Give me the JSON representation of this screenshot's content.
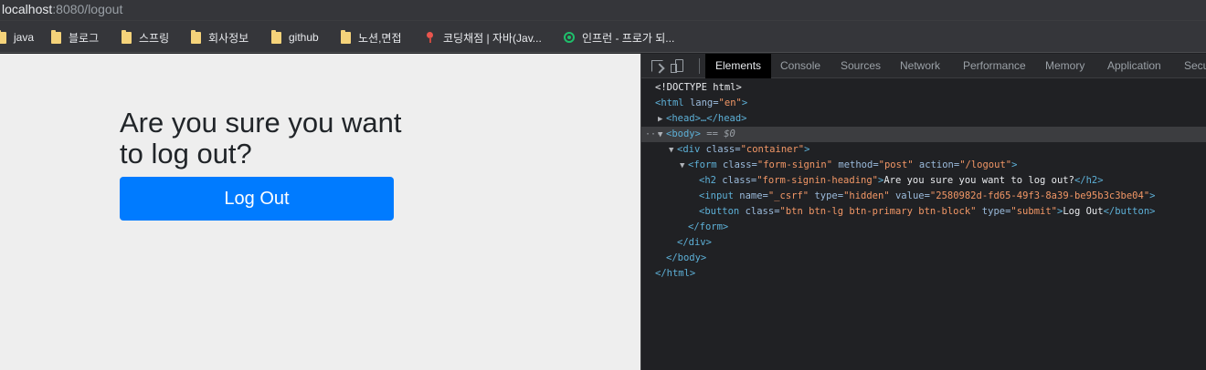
{
  "address_bar": {
    "host": "localhost",
    "rest": ":8080/logout"
  },
  "bookmarks": [
    {
      "label": "java",
      "icon": "folder-icon"
    },
    {
      "label": "블로그",
      "icon": "folder-icon"
    },
    {
      "label": "스프링",
      "icon": "folder-icon"
    },
    {
      "label": "회사정보",
      "icon": "folder-icon"
    },
    {
      "label": "github",
      "icon": "folder-icon"
    },
    {
      "label": "노션,면접",
      "icon": "folder-icon"
    },
    {
      "label": "코딩채점 | 자바(Jav...",
      "icon": "coding-favicon"
    },
    {
      "label": "인프런 - 프로가 되...",
      "icon": "inflearn-favicon"
    }
  ],
  "page": {
    "heading": "Are you sure you want to log out?",
    "button_label": "Log Out",
    "button_color": "#007bff",
    "background": "#eeeeee"
  },
  "devtools": {
    "tabs": [
      "Elements",
      "Console",
      "Sources",
      "Network",
      "Performance",
      "Memory",
      "Application",
      "Secu"
    ],
    "active_tab": "Elements",
    "tree": {
      "doctype": "<!DOCTYPE html>",
      "html_open": "<html",
      "html_lang_attr": "lang=",
      "html_lang_val": "\"en\"",
      "head_collapsed": "<head>…</head>",
      "body_open": "<body>",
      "body_eq": "== $0",
      "div_open": "<div",
      "div_attr": "class=",
      "div_val": "\"container\"",
      "form_open": "<form",
      "form_class_attr": "class=",
      "form_class_val": "\"form-signin\"",
      "form_method_attr": "method=",
      "form_method_val": "\"post\"",
      "form_action_attr": "action=",
      "form_action_val": "\"/logout\"",
      "h2_open": "<h2",
      "h2_attr": "class=",
      "h2_val": "\"form-signin-heading\"",
      "h2_text": "Are you sure you want to log out?",
      "h2_close": "</h2>",
      "input_open": "<input",
      "input_name_attr": "name=",
      "input_name_val": "\"_csrf\"",
      "input_type_attr": "type=",
      "input_type_val": "\"hidden\"",
      "input_value_attr": "value=",
      "input_value_val": "\"2580982d-fd65-49f3-8a39-be95b3c3be04\"",
      "button_open": "<button",
      "button_class_attr": "class=",
      "button_class_val": "\"btn btn-lg btn-primary btn-block\"",
      "button_type_attr": "type=",
      "button_type_val": "\"submit\"",
      "button_text": "Log Out",
      "button_close": "</button>",
      "form_close": "</form>",
      "div_close": "</div>",
      "body_close": "</body>",
      "html_close": "</html>"
    }
  }
}
